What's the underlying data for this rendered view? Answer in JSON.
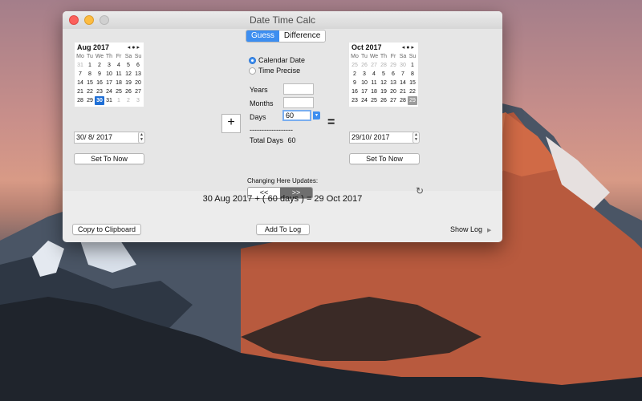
{
  "window": {
    "title": "Date Time Calc"
  },
  "tabs": [
    {
      "label": "Guess",
      "selected": true
    },
    {
      "label": "Difference",
      "selected": false
    }
  ],
  "left_calendar": {
    "month": "Aug 2017",
    "nav": "◂●▸",
    "weekdays": [
      "Mo",
      "Tu",
      "We",
      "Th",
      "Fr",
      "Sa",
      "Su"
    ],
    "days": [
      "31",
      "1",
      "2",
      "3",
      "4",
      "5",
      "6",
      "7",
      "8",
      "9",
      "10",
      "11",
      "12",
      "13",
      "14",
      "15",
      "16",
      "17",
      "18",
      "19",
      "20",
      "21",
      "22",
      "23",
      "24",
      "25",
      "26",
      "27",
      "28",
      "29",
      "30",
      "31",
      "1",
      "2",
      "3"
    ],
    "dim": [
      0,
      32,
      33,
      34
    ],
    "selected_index": 30,
    "date_field": "30/  8/ 2017",
    "set_to_now": "Set To Now"
  },
  "right_calendar": {
    "month": "Oct 2017",
    "nav": "◂●▸",
    "weekdays": [
      "Mo",
      "Tu",
      "We",
      "Th",
      "Fr",
      "Sa",
      "Su"
    ],
    "days": [
      "25",
      "26",
      "27",
      "28",
      "29",
      "30",
      "1",
      "2",
      "3",
      "4",
      "5",
      "6",
      "7",
      "8",
      "9",
      "10",
      "11",
      "12",
      "13",
      "14",
      "15",
      "16",
      "17",
      "18",
      "19",
      "20",
      "21",
      "22",
      "23",
      "24",
      "25",
      "26",
      "27",
      "28",
      "29"
    ],
    "dim": [
      0,
      1,
      2,
      3,
      4,
      5
    ],
    "selected_index": 34,
    "date_field": "29/10/ 2017",
    "set_to_now": "Set To Now"
  },
  "mode": {
    "calendar_date": "Calendar Date",
    "time_precise": "Time Precise",
    "selected": "Calendar Date"
  },
  "fields": {
    "years_label": "Years",
    "years_value": "",
    "months_label": "Months",
    "months_value": "",
    "days_label": "Days",
    "days_value": "60"
  },
  "operator": "+",
  "equals": "=",
  "dashes": "------------------",
  "total_days_label": "Total Days",
  "total_days_value": "60",
  "changing_here": "Changing Here Updates:",
  "direction": {
    "left": "<<",
    "right": ">>",
    "selected": ">>"
  },
  "result": "30 Aug 2017 + ( 60 days ) = 29 Oct 2017",
  "buttons": {
    "copy": "Copy to Clipboard",
    "add_log": "Add To Log",
    "show_log": "Show Log"
  },
  "icons": {
    "refresh": "refresh-icon",
    "disclosure": "disclosure-triangle-icon"
  },
  "colors": {
    "accent": "#3d8ef0",
    "selected_day": "#1f6fd6"
  }
}
